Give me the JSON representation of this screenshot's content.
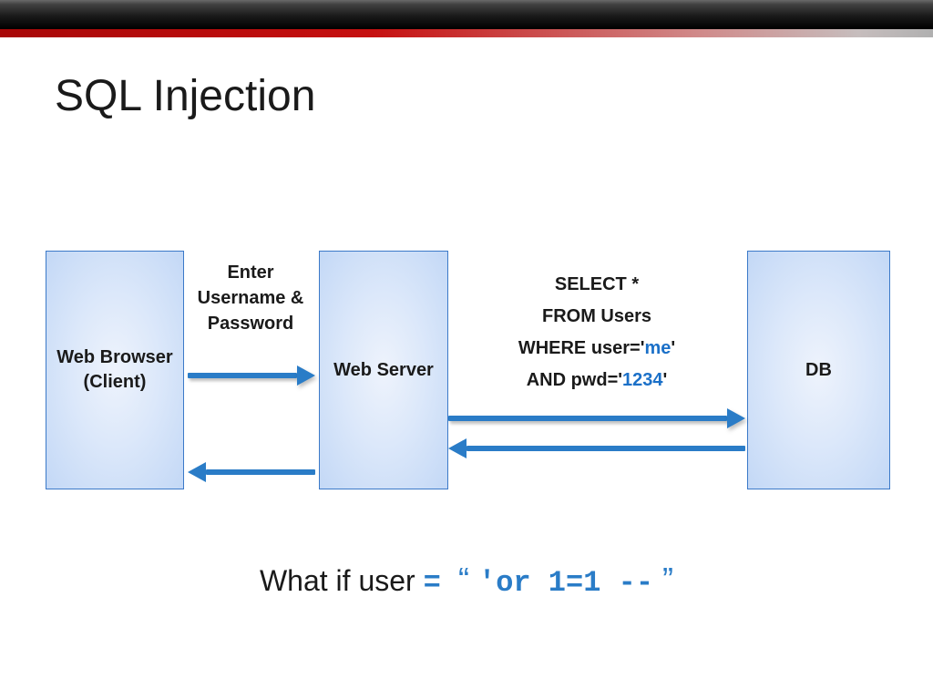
{
  "title": "SQL Injection",
  "nodes": {
    "browser": "Web Browser (Client)",
    "server": "Web Server",
    "db": "DB"
  },
  "labels": {
    "credentials": "Enter Username & Password"
  },
  "sql": {
    "l1": "SELECT *",
    "l2": "FROM Users",
    "l3a": "WHERE user='",
    "l3v": "me",
    "l3b": "'",
    "l4a": "AND pwd='",
    "l4v": "1234",
    "l4b": "'"
  },
  "bottom": {
    "prefix": "What if user ",
    "eq": "= ",
    "lq": "“ ",
    "payload": "'or 1=1 --",
    "rq": " ”"
  }
}
